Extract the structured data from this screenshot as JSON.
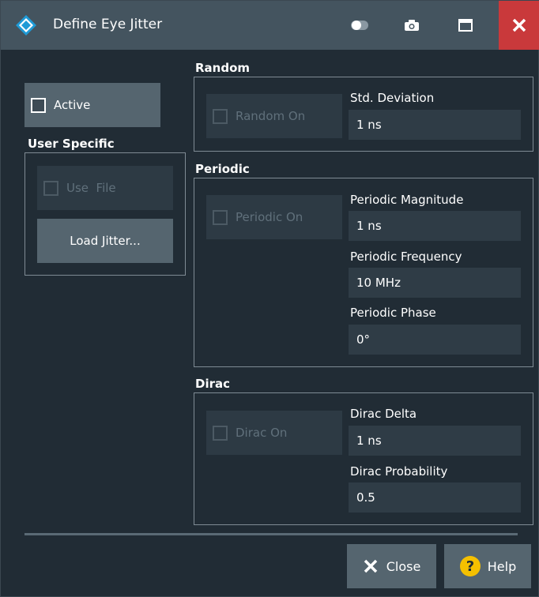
{
  "window": {
    "title": "Define Eye Jitter"
  },
  "titlebar_icons": [
    "toggle-icon",
    "camera-icon",
    "maximize-icon",
    "close-icon"
  ],
  "left": {
    "active": {
      "label": "Active",
      "checked": false
    },
    "user_specific": {
      "heading": "User Specific",
      "use_file": {
        "label": "Use  File",
        "checked": false,
        "enabled": false
      },
      "load_button": "Load Jitter..."
    }
  },
  "random": {
    "heading": "Random",
    "toggle": {
      "label": "Random On",
      "checked": false,
      "enabled": false
    },
    "std_dev_label": "Std. Deviation",
    "std_dev_value": "1 ns"
  },
  "periodic": {
    "heading": "Periodic",
    "toggle": {
      "label": "Periodic On",
      "checked": false,
      "enabled": false
    },
    "magnitude_label": "Periodic Magnitude",
    "magnitude_value": "1 ns",
    "frequency_label": "Periodic Frequency",
    "frequency_value": "10 MHz",
    "phase_label": "Periodic Phase",
    "phase_value": "0°"
  },
  "dirac": {
    "heading": "Dirac",
    "toggle": {
      "label": "Dirac On",
      "checked": false,
      "enabled": false
    },
    "delta_label": "Dirac Delta",
    "delta_value": "1 ns",
    "probability_label": "Dirac Probability",
    "probability_value": "0.5"
  },
  "footer": {
    "close_label": "Close",
    "help_label": "Help"
  },
  "colors": {
    "titlebar": "#44545f",
    "background": "#212c35",
    "close_red": "#c9393b",
    "help_yellow": "#f5c000"
  }
}
